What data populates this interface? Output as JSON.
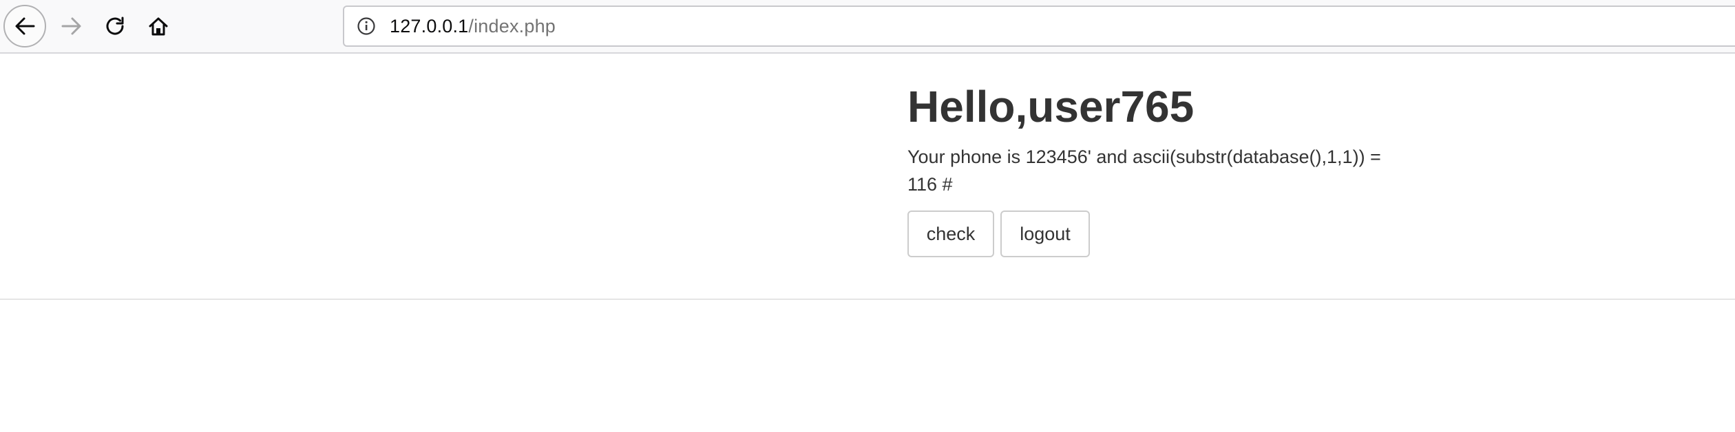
{
  "browser": {
    "url_host": "127.0.0.1",
    "url_path": "/index.php",
    "icons": {
      "back": "arrow-left-icon",
      "forward": "arrow-right-icon",
      "reload": "reload-icon",
      "home": "home-icon",
      "site_info": "info-icon"
    },
    "forward_enabled": false
  },
  "page": {
    "greeting": "Hello,user765",
    "phone_text": "Your phone is 123456' and ascii(substr(database(),1,1)) = 116 #",
    "buttons": {
      "check_label": "check",
      "logout_label": "logout"
    }
  },
  "colors": {
    "text": "#333333",
    "toolbar_bg": "#f9f9fa",
    "button_border": "#cccccc"
  }
}
